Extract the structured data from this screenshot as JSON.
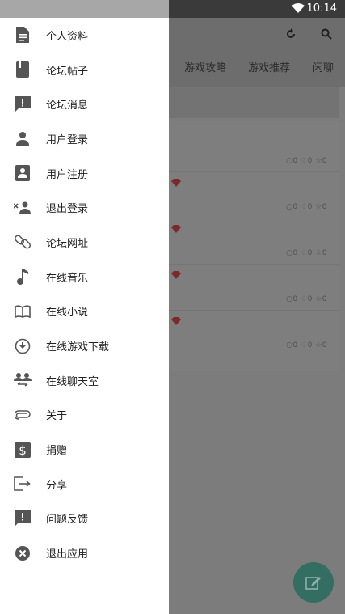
{
  "status_bar": {
    "time": "10:14"
  },
  "tabs": [
    "游戏攻略",
    "游戏推荐",
    "闲聊"
  ],
  "posts": [
    {
      "stats": "○0 ♢0 ☆0"
    },
    {
      "stats": "○0 ♢0 ☆0"
    },
    {
      "stats": "○0 ♢0 ☆0"
    },
    {
      "stats": "○0 ♢0 ☆0"
    },
    {
      "stats": "○0 ♢0 ☆0"
    }
  ],
  "drawer": {
    "items": [
      {
        "label": "个人资料",
        "icon": "document-icon"
      },
      {
        "label": "论坛帖子",
        "icon": "book-icon"
      },
      {
        "label": "论坛消息",
        "icon": "message-alert-icon"
      },
      {
        "label": "用户登录",
        "icon": "person-icon"
      },
      {
        "label": "用户注册",
        "icon": "contact-card-icon"
      },
      {
        "label": "退出登录",
        "icon": "remove-user-icon"
      },
      {
        "label": "论坛网址",
        "icon": "link-icon"
      },
      {
        "label": "在线音乐",
        "icon": "music-note-icon"
      },
      {
        "label": "在线小说",
        "icon": "open-book-icon"
      },
      {
        "label": "在线游戏下载",
        "icon": "download-circle-icon"
      },
      {
        "label": "在线聊天室",
        "icon": "group-chat-icon"
      },
      {
        "label": "关于",
        "icon": "paperclip-icon"
      },
      {
        "label": "捐赠",
        "icon": "dollar-icon"
      },
      {
        "label": "分享",
        "icon": "share-exit-icon"
      },
      {
        "label": "问题反馈",
        "icon": "feedback-icon"
      },
      {
        "label": "退出应用",
        "icon": "close-circle-icon"
      }
    ]
  },
  "colors": {
    "drawer_bg": "#ffffff",
    "scrim": "#7c7c7c",
    "fab": "#346d61",
    "icon": "#555555"
  }
}
